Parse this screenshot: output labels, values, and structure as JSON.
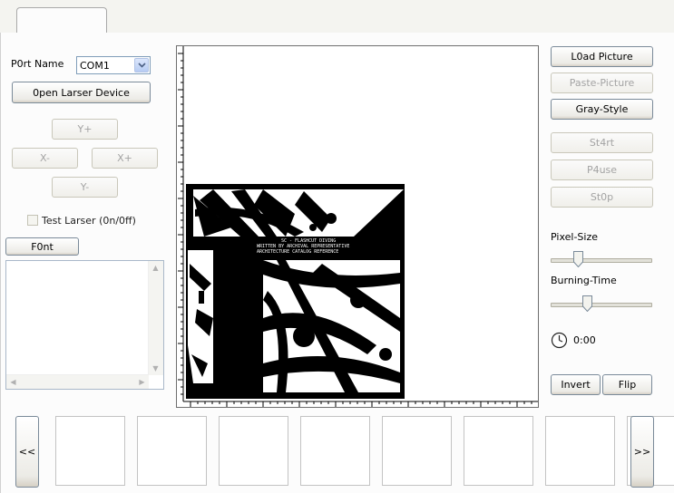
{
  "tabs": [
    {
      "label": ""
    }
  ],
  "port": {
    "label": "P0rt Name",
    "value": "COM1"
  },
  "buttons": {
    "open_device": "0pen Larser Device",
    "y_plus": "Y+",
    "x_minus": "X-",
    "x_plus": "X+",
    "y_minus": "Y-",
    "font": "F0nt",
    "load_picture": "L0ad Picture",
    "paste_picture": "Paste-Picture",
    "gray_style": "Gray-Style",
    "start": "St4rt",
    "pause": "P4use",
    "stop": "St0p",
    "invert": "Invert",
    "flip": "Flip",
    "prev": "<<",
    "next": ">>"
  },
  "test_larser": {
    "label": "Test Larser (0n/0ff)",
    "checked": false
  },
  "pixel_size": {
    "label": "Pixel-Size",
    "value": 0.25
  },
  "burning_time": {
    "label": "Burning-Time",
    "value": 0.35
  },
  "timer": {
    "value": "0:00"
  },
  "image_text": {
    "line1": "SC - FLASHCUT DIVING",
    "line2": "WRITTEN BY ARCHIVAL REPRESENTATIVE",
    "line3": "ARCHITECTURE CATALOG REFERENCE"
  },
  "buttons_state": {
    "enabled_color": "#000000",
    "disabled_color": "#a3a3a3"
  },
  "thumbnails": [
    "",
    "",
    "",
    "",
    "",
    "",
    "",
    ""
  ]
}
